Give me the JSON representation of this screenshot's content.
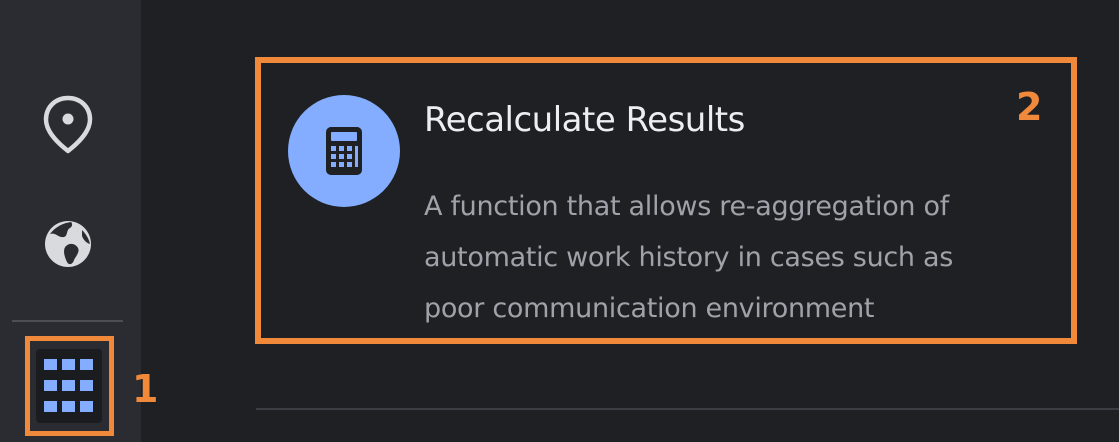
{
  "sidebar": {
    "items": [
      {
        "icon": "location-pin-icon"
      },
      {
        "icon": "globe-icon"
      },
      {
        "icon": "apps-grid-icon",
        "active": true
      }
    ]
  },
  "callouts": {
    "one": "1",
    "two": "2"
  },
  "card": {
    "icon": "calculator-icon",
    "title": "Recalculate Results",
    "description_lines": [
      "A function that allows re-aggregation of",
      "automatic work history in cases such as",
      "poor communication environment"
    ]
  },
  "colors": {
    "background": "#1e2024",
    "sidebar": "#2a2c31",
    "highlight": "#f08a3a",
    "accent": "#84adff",
    "title": "#eceef0",
    "description": "#9fa3a9"
  }
}
